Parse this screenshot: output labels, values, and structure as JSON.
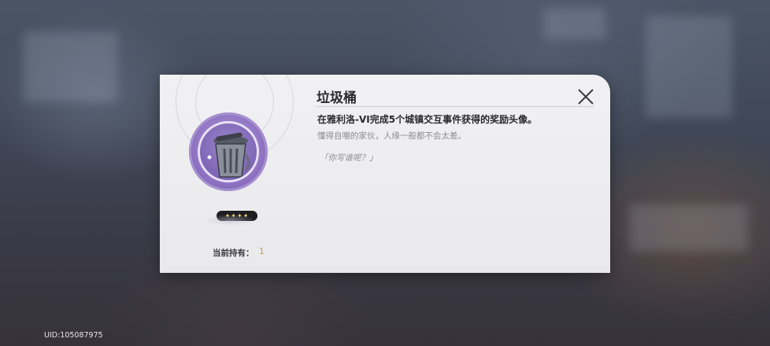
{
  "dialog": {
    "title": "垃圾桶",
    "description": "在雅利洛-VI完成5个城镇交互事件获得的奖励头像。",
    "flavor_text": "懂得自嘲的家伙，人缘一般都不会太差。",
    "quote": "「你写谁呢？」",
    "rarity_stars": "✦✦✦✦",
    "holding_label": "当前持有：",
    "holding_count": "1",
    "close_icon": "close-icon",
    "avatar_icon": "trash-can-avatar-icon"
  },
  "footer": {
    "uid": "UID:105087975"
  },
  "colors": {
    "accent_purple": "#8f73c2",
    "count_gold": "#c79a3a",
    "panel_bg": "#f1f1f3"
  }
}
